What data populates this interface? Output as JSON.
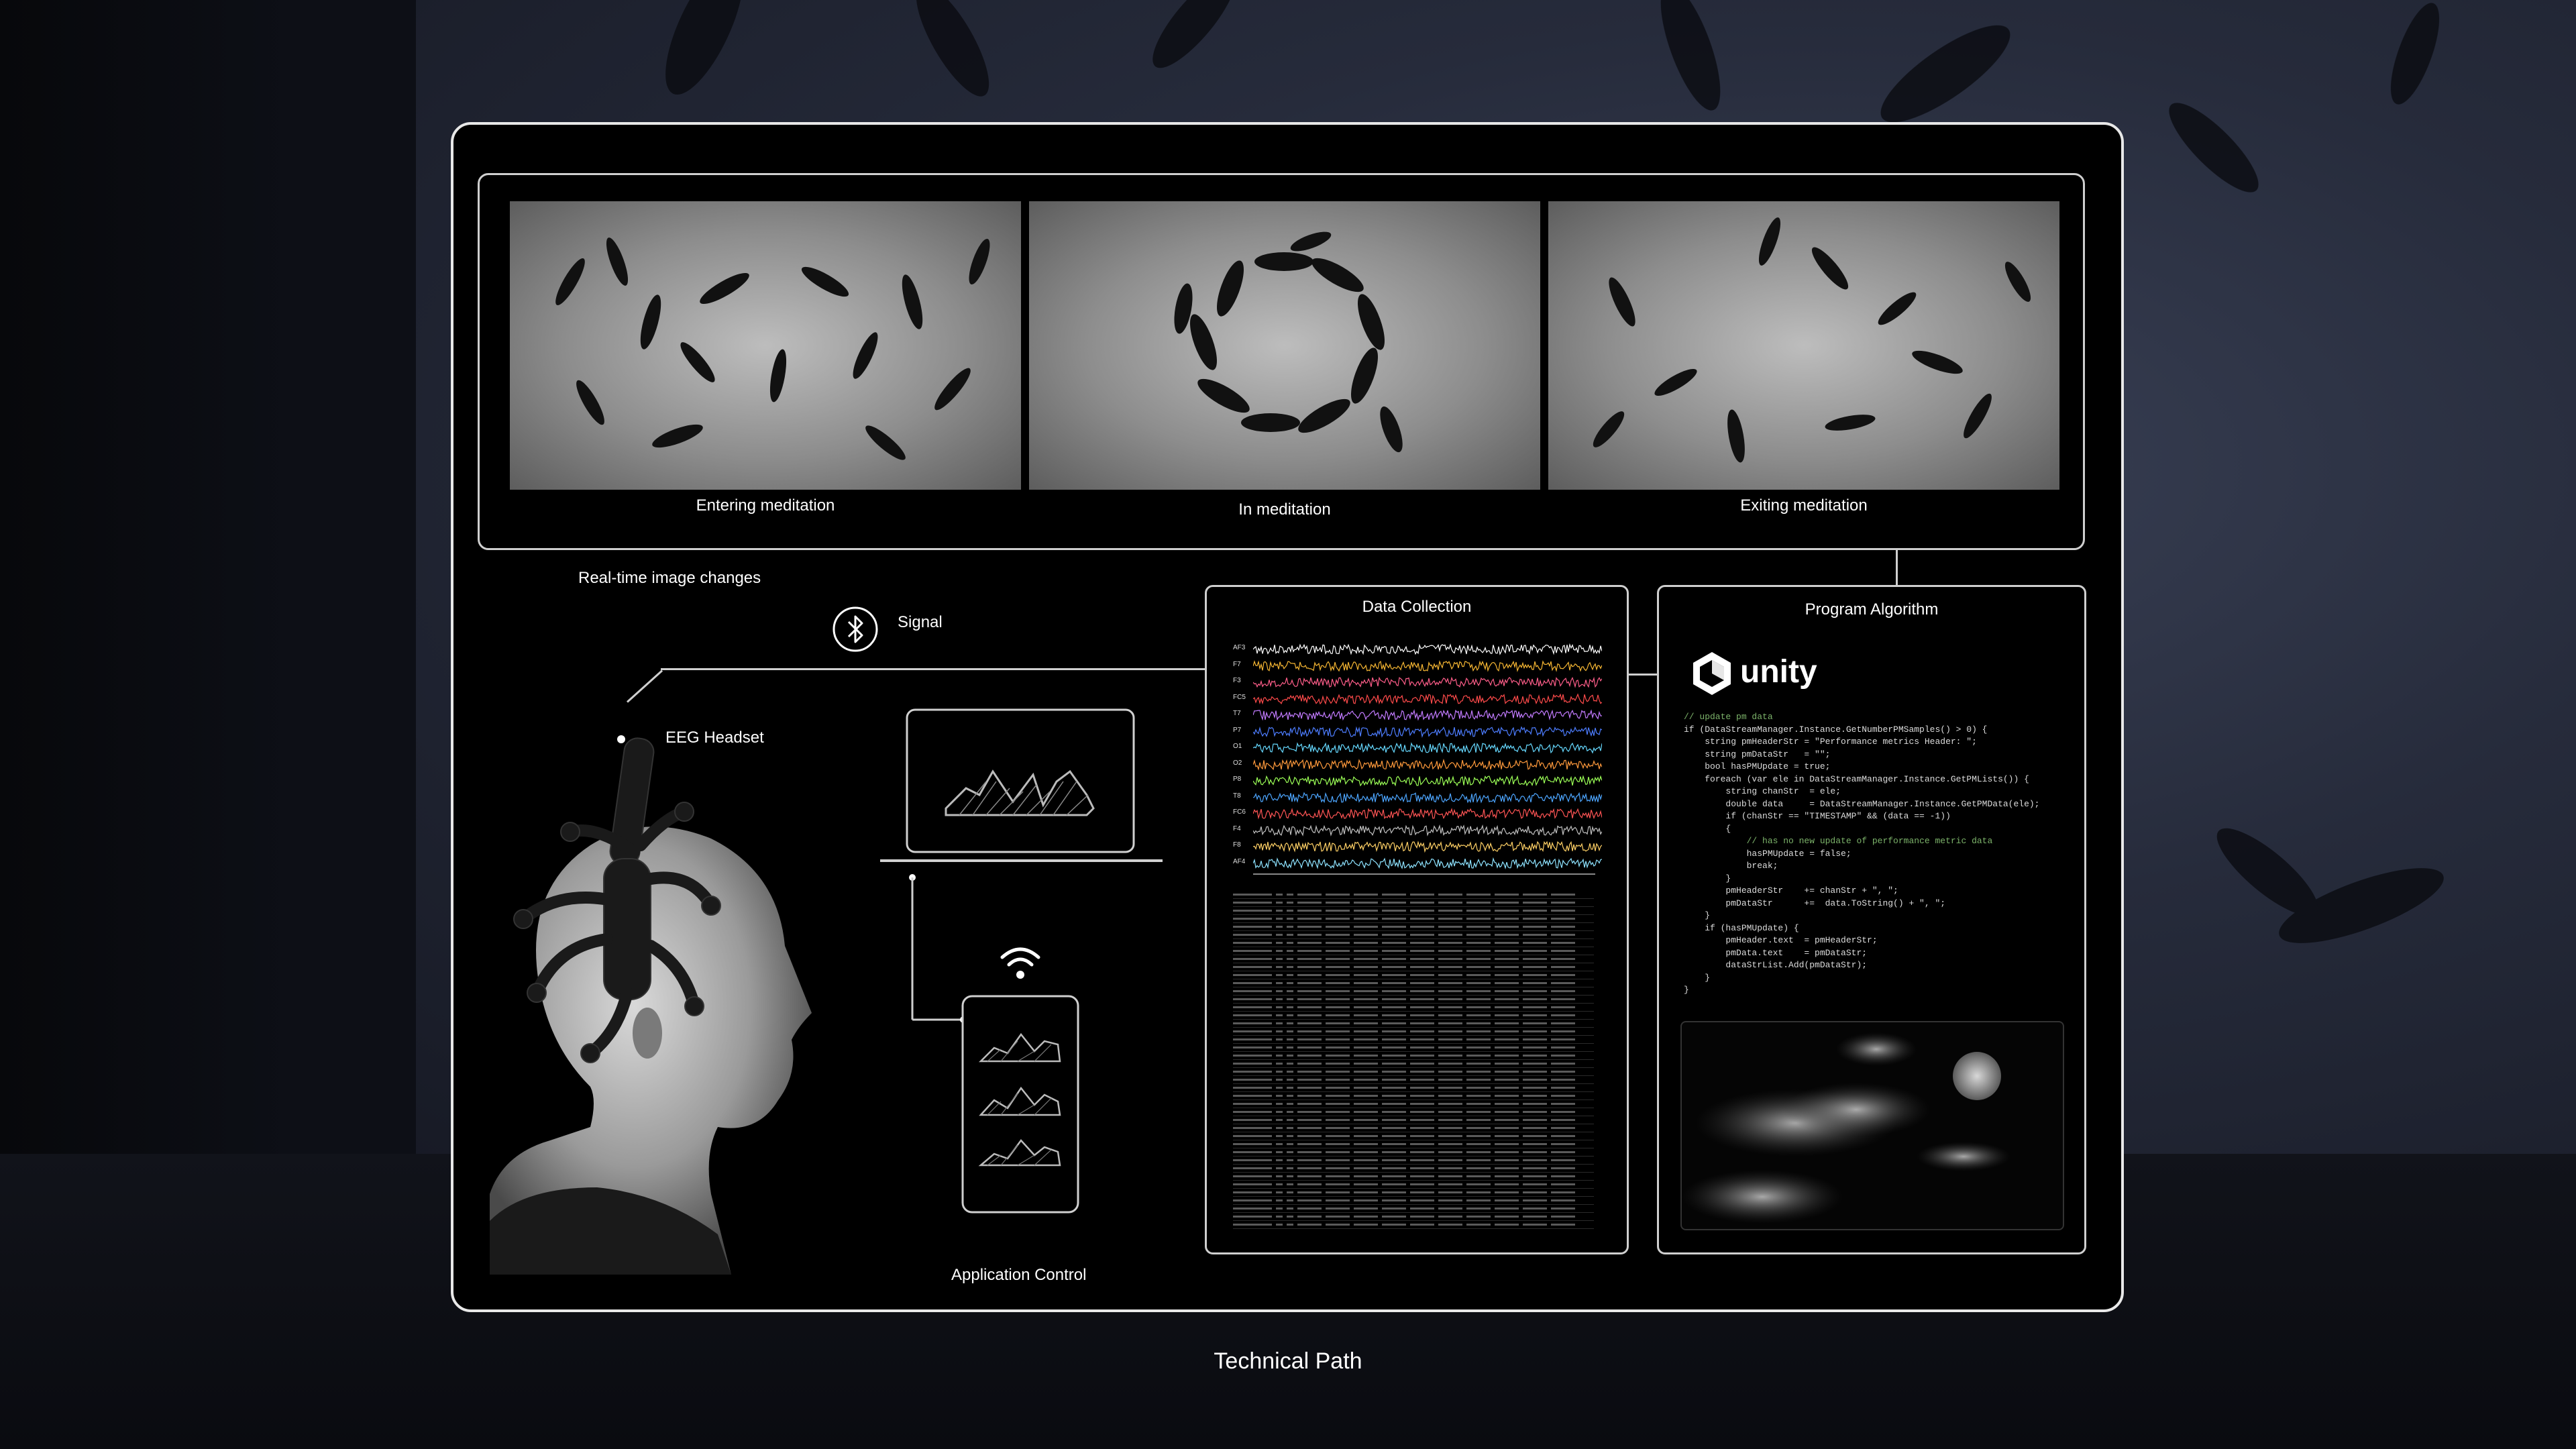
{
  "captions": {
    "entering": "Entering meditation",
    "in": "In meditation",
    "exiting": "Exiting meditation"
  },
  "labels": {
    "realtime": "Real-time image changes",
    "signal": "Signal",
    "headset": "EEG  Headset",
    "app_control": "Application Control",
    "data_collection": "Data Collection",
    "program_algorithm": "Program Algorithm",
    "unity": "unity",
    "page_title": "Technical Path"
  },
  "eeg_channels": [
    "AF3",
    "F7",
    "F3",
    "FC5",
    "T7",
    "P7",
    "O1",
    "O2",
    "P8",
    "T8",
    "FC6",
    "F4",
    "F8",
    "AF4"
  ],
  "eeg_colors": [
    "#ffffff",
    "#f7b733",
    "#ff5e8a",
    "#ff4b4b",
    "#c27bff",
    "#4d7dff",
    "#66d9ff",
    "#ff9a3c",
    "#9cff57",
    "#4da6ff",
    "#ff5555",
    "#c0c0c0",
    "#ffd166",
    "#8ee3ff"
  ],
  "code_lines": [
    "// update pm data",
    "if (DataStreamManager.Instance.GetNumberPMSamples() > 0) {",
    "    string pmHeaderStr = \"Performance metrics Header: \";",
    "    string pmDataStr   = \"\";",
    "    bool hasPMUpdate = true;",
    "    foreach (var ele in DataStreamManager.Instance.GetPMLists()) {",
    "        string chanStr  = ele;",
    "        double data     = DataStreamManager.Instance.GetPMData(ele);",
    "        if (chanStr == \"TIMESTAMP\" && (data == -1))",
    "        {",
    "            // has no new update of performance metric data",
    "            hasPMUpdate = false;",
    "            break;",
    "        }",
    "        pmHeaderStr    += chanStr + \", \";",
    "        pmDataStr      +=  data.ToString() + \", \";",
    "    }",
    "    if (hasPMUpdate) {",
    "        pmHeader.text  = pmHeaderStr;",
    "        pmData.text    = pmDataStr;",
    "        dataStrList.Add(pmDataStr);",
    "    }",
    "}"
  ]
}
